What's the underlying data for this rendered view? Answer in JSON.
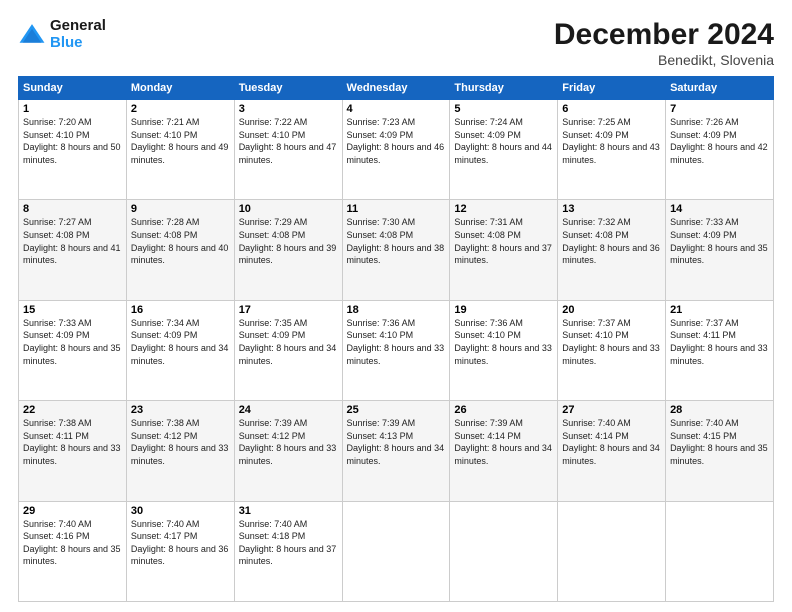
{
  "header": {
    "logo_line1": "General",
    "logo_line2": "Blue",
    "month_title": "December 2024",
    "location": "Benedikt, Slovenia"
  },
  "weekdays": [
    "Sunday",
    "Monday",
    "Tuesday",
    "Wednesday",
    "Thursday",
    "Friday",
    "Saturday"
  ],
  "weeks": [
    [
      {
        "day": "1",
        "sunrise": "7:20 AM",
        "sunset": "4:10 PM",
        "daylight": "8 hours and 50 minutes."
      },
      {
        "day": "2",
        "sunrise": "7:21 AM",
        "sunset": "4:10 PM",
        "daylight": "8 hours and 49 minutes."
      },
      {
        "day": "3",
        "sunrise": "7:22 AM",
        "sunset": "4:10 PM",
        "daylight": "8 hours and 47 minutes."
      },
      {
        "day": "4",
        "sunrise": "7:23 AM",
        "sunset": "4:09 PM",
        "daylight": "8 hours and 46 minutes."
      },
      {
        "day": "5",
        "sunrise": "7:24 AM",
        "sunset": "4:09 PM",
        "daylight": "8 hours and 44 minutes."
      },
      {
        "day": "6",
        "sunrise": "7:25 AM",
        "sunset": "4:09 PM",
        "daylight": "8 hours and 43 minutes."
      },
      {
        "day": "7",
        "sunrise": "7:26 AM",
        "sunset": "4:09 PM",
        "daylight": "8 hours and 42 minutes."
      }
    ],
    [
      {
        "day": "8",
        "sunrise": "7:27 AM",
        "sunset": "4:08 PM",
        "daylight": "8 hours and 41 minutes."
      },
      {
        "day": "9",
        "sunrise": "7:28 AM",
        "sunset": "4:08 PM",
        "daylight": "8 hours and 40 minutes."
      },
      {
        "day": "10",
        "sunrise": "7:29 AM",
        "sunset": "4:08 PM",
        "daylight": "8 hours and 39 minutes."
      },
      {
        "day": "11",
        "sunrise": "7:30 AM",
        "sunset": "4:08 PM",
        "daylight": "8 hours and 38 minutes."
      },
      {
        "day": "12",
        "sunrise": "7:31 AM",
        "sunset": "4:08 PM",
        "daylight": "8 hours and 37 minutes."
      },
      {
        "day": "13",
        "sunrise": "7:32 AM",
        "sunset": "4:08 PM",
        "daylight": "8 hours and 36 minutes."
      },
      {
        "day": "14",
        "sunrise": "7:33 AM",
        "sunset": "4:09 PM",
        "daylight": "8 hours and 35 minutes."
      }
    ],
    [
      {
        "day": "15",
        "sunrise": "7:33 AM",
        "sunset": "4:09 PM",
        "daylight": "8 hours and 35 minutes."
      },
      {
        "day": "16",
        "sunrise": "7:34 AM",
        "sunset": "4:09 PM",
        "daylight": "8 hours and 34 minutes."
      },
      {
        "day": "17",
        "sunrise": "7:35 AM",
        "sunset": "4:09 PM",
        "daylight": "8 hours and 34 minutes."
      },
      {
        "day": "18",
        "sunrise": "7:36 AM",
        "sunset": "4:10 PM",
        "daylight": "8 hours and 33 minutes."
      },
      {
        "day": "19",
        "sunrise": "7:36 AM",
        "sunset": "4:10 PM",
        "daylight": "8 hours and 33 minutes."
      },
      {
        "day": "20",
        "sunrise": "7:37 AM",
        "sunset": "4:10 PM",
        "daylight": "8 hours and 33 minutes."
      },
      {
        "day": "21",
        "sunrise": "7:37 AM",
        "sunset": "4:11 PM",
        "daylight": "8 hours and 33 minutes."
      }
    ],
    [
      {
        "day": "22",
        "sunrise": "7:38 AM",
        "sunset": "4:11 PM",
        "daylight": "8 hours and 33 minutes."
      },
      {
        "day": "23",
        "sunrise": "7:38 AM",
        "sunset": "4:12 PM",
        "daylight": "8 hours and 33 minutes."
      },
      {
        "day": "24",
        "sunrise": "7:39 AM",
        "sunset": "4:12 PM",
        "daylight": "8 hours and 33 minutes."
      },
      {
        "day": "25",
        "sunrise": "7:39 AM",
        "sunset": "4:13 PM",
        "daylight": "8 hours and 34 minutes."
      },
      {
        "day": "26",
        "sunrise": "7:39 AM",
        "sunset": "4:14 PM",
        "daylight": "8 hours and 34 minutes."
      },
      {
        "day": "27",
        "sunrise": "7:40 AM",
        "sunset": "4:14 PM",
        "daylight": "8 hours and 34 minutes."
      },
      {
        "day": "28",
        "sunrise": "7:40 AM",
        "sunset": "4:15 PM",
        "daylight": "8 hours and 35 minutes."
      }
    ],
    [
      {
        "day": "29",
        "sunrise": "7:40 AM",
        "sunset": "4:16 PM",
        "daylight": "8 hours and 35 minutes."
      },
      {
        "day": "30",
        "sunrise": "7:40 AM",
        "sunset": "4:17 PM",
        "daylight": "8 hours and 36 minutes."
      },
      {
        "day": "31",
        "sunrise": "7:40 AM",
        "sunset": "4:18 PM",
        "daylight": "8 hours and 37 minutes."
      },
      null,
      null,
      null,
      null
    ]
  ],
  "labels": {
    "sunrise": "Sunrise:",
    "sunset": "Sunset:",
    "daylight": "Daylight:"
  }
}
